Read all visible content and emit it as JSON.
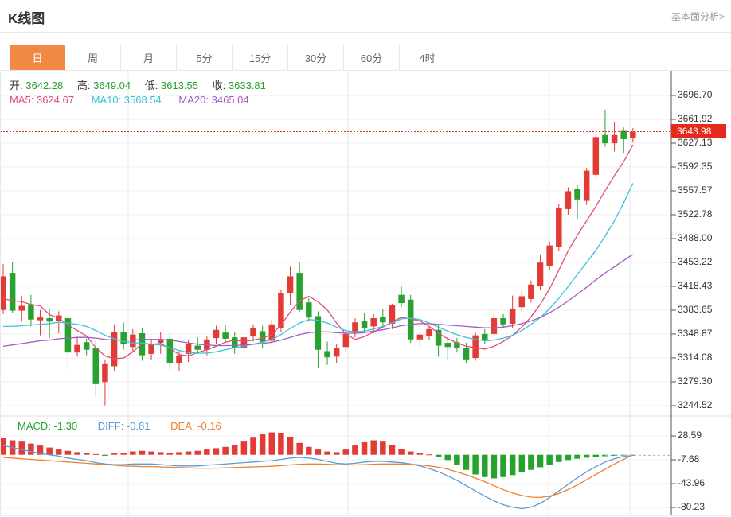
{
  "header": {
    "title": "K线图",
    "link": "基本面分析>"
  },
  "tabs": {
    "active_index": 0,
    "items": [
      {
        "key": "tab-day",
        "label": "日"
      },
      {
        "key": "tab-week",
        "label": "周"
      },
      {
        "key": "tab-month",
        "label": "月"
      },
      {
        "key": "tab-5min",
        "label": "5分"
      },
      {
        "key": "tab-15min",
        "label": "15分"
      },
      {
        "key": "tab-30min",
        "label": "30分"
      },
      {
        "key": "tab-60min",
        "label": "60分"
      },
      {
        "key": "tab-4hour",
        "label": "4时"
      }
    ]
  },
  "quote": {
    "open_label": "开:",
    "open": "3642.28",
    "high_label": "高:",
    "high": "3649.04",
    "low_label": "低:",
    "low": "3613.55",
    "close_label": "收:",
    "close": "3633.81"
  },
  "ma_info": {
    "ma5_label": "MA5:",
    "ma5": "3624.67",
    "ma10_label": "MA10:",
    "ma10": "3568.54",
    "ma20_label": "MA20:",
    "ma20": "3465.04"
  },
  "macd_info": {
    "macd_label": "MACD:",
    "macd": "-1.30",
    "diff_label": "DIFF:",
    "diff": "-0.81",
    "dea_label": "DEA:",
    "dea": "-0.16"
  },
  "price_marker": "3643.98",
  "colors": {
    "up": "#e23a34",
    "down": "#27a22e",
    "ma5": "#e14d78",
    "ma10": "#3bc2da",
    "ma20": "#a55bc1",
    "diff": "#5b9bd5",
    "dea": "#ed8132",
    "macd_green": "#27a22e",
    "accent_tab": "#f08a42",
    "marker": "#e5291d",
    "grid": "#efefef",
    "vgrid": "#e7e7e7",
    "axis": "#555555",
    "text": "#333333"
  },
  "chart_data": {
    "type": "candlestick+macd",
    "title": "K线图 日K",
    "legend": [
      "MA5",
      "MA10",
      "MA20",
      "MACD",
      "DIFF",
      "DEA"
    ],
    "main_axis_ticks": [
      3696.7,
      3661.92,
      3627.13,
      3592.35,
      3557.57,
      3522.78,
      3488.0,
      3453.22,
      3418.43,
      3383.65,
      3348.87,
      3314.08,
      3279.3,
      3244.52
    ],
    "current_price": 3643.98,
    "candles_ohlc": [
      [
        3384,
        3451,
        3378,
        3433
      ],
      [
        3438,
        3453,
        3380,
        3383
      ],
      [
        3383,
        3405,
        3367,
        3390
      ],
      [
        3392,
        3406,
        3360,
        3370
      ],
      [
        3369,
        3384,
        3347,
        3373
      ],
      [
        3372,
        3386,
        3343,
        3367
      ],
      [
        3368,
        3382,
        3350,
        3376
      ],
      [
        3372,
        3376,
        3297,
        3322
      ],
      [
        3322,
        3345,
        3316,
        3333
      ],
      [
        3337,
        3342,
        3318,
        3326
      ],
      [
        3329,
        3340,
        3258,
        3276
      ],
      [
        3279,
        3312,
        3245,
        3305
      ],
      [
        3302,
        3363,
        3295,
        3352
      ],
      [
        3352,
        3366,
        3326,
        3334
      ],
      [
        3330,
        3356,
        3322,
        3348
      ],
      [
        3350,
        3358,
        3310,
        3318
      ],
      [
        3320,
        3340,
        3312,
        3334
      ],
      [
        3336,
        3352,
        3320,
        3340
      ],
      [
        3342,
        3350,
        3297,
        3306
      ],
      [
        3306,
        3324,
        3295,
        3318
      ],
      [
        3320,
        3340,
        3308,
        3334
      ],
      [
        3332,
        3344,
        3320,
        3326
      ],
      [
        3326,
        3346,
        3318,
        3341
      ],
      [
        3343,
        3361,
        3335,
        3355
      ],
      [
        3351,
        3362,
        3336,
        3342
      ],
      [
        3344,
        3352,
        3320,
        3328
      ],
      [
        3328,
        3348,
        3322,
        3344
      ],
      [
        3346,
        3363,
        3338,
        3357
      ],
      [
        3353,
        3361,
        3329,
        3337
      ],
      [
        3339,
        3370,
        3333,
        3363
      ],
      [
        3357,
        3414,
        3351,
        3409
      ],
      [
        3409,
        3447,
        3391,
        3433
      ],
      [
        3438,
        3453,
        3381,
        3384
      ],
      [
        3395,
        3401,
        3367,
        3373
      ],
      [
        3375,
        3382,
        3299,
        3326
      ],
      [
        3324,
        3338,
        3304,
        3315
      ],
      [
        3316,
        3334,
        3306,
        3328
      ],
      [
        3330,
        3355,
        3324,
        3349
      ],
      [
        3351,
        3372,
        3344,
        3366
      ],
      [
        3368,
        3380,
        3352,
        3358
      ],
      [
        3360,
        3378,
        3350,
        3372
      ],
      [
        3374,
        3386,
        3360,
        3366
      ],
      [
        3364,
        3393,
        3356,
        3391
      ],
      [
        3406,
        3418,
        3388,
        3394
      ],
      [
        3399,
        3406,
        3336,
        3341
      ],
      [
        3341,
        3352,
        3328,
        3348
      ],
      [
        3346,
        3360,
        3340,
        3356
      ],
      [
        3355,
        3362,
        3316,
        3332
      ],
      [
        3336,
        3344,
        3312,
        3330
      ],
      [
        3337,
        3343,
        3322,
        3328
      ],
      [
        3329,
        3336,
        3306,
        3312
      ],
      [
        3314,
        3352,
        3310,
        3347
      ],
      [
        3349,
        3356,
        3334,
        3339
      ],
      [
        3349,
        3384,
        3343,
        3372
      ],
      [
        3372,
        3378,
        3358,
        3363
      ],
      [
        3364,
        3405,
        3357,
        3386
      ],
      [
        3388,
        3412,
        3382,
        3404
      ],
      [
        3400,
        3427,
        3395,
        3421
      ],
      [
        3419,
        3465,
        3413,
        3453
      ],
      [
        3448,
        3484,
        3442,
        3478
      ],
      [
        3476,
        3539,
        3470,
        3533
      ],
      [
        3531,
        3563,
        3523,
        3557
      ],
      [
        3560,
        3566,
        3517,
        3545
      ],
      [
        3543,
        3591,
        3537,
        3587
      ],
      [
        3581,
        3641,
        3575,
        3636
      ],
      [
        3639,
        3676,
        3622,
        3627
      ],
      [
        3627,
        3658,
        3615,
        3639
      ],
      [
        3645,
        3650,
        3613,
        3633
      ],
      [
        3634,
        3649,
        3628,
        3644
      ]
    ],
    "ma5": [
      3400,
      3398,
      3396,
      3392,
      3390,
      3377,
      3372,
      3362,
      3354,
      3346,
      3329,
      3317,
      3313,
      3314,
      3323,
      3335,
      3334,
      3335,
      3328,
      3319,
      3317,
      3322,
      3326,
      3331,
      3337,
      3340,
      3338,
      3340,
      3343,
      3348,
      3362,
      3381,
      3397,
      3404,
      3396,
      3384,
      3365,
      3349,
      3341,
      3345,
      3352,
      3359,
      3367,
      3373,
      3371,
      3368,
      3360,
      3350,
      3342,
      3336,
      3331,
      3329,
      3327,
      3331,
      3338,
      3347,
      3359,
      3374,
      3392,
      3415,
      3442,
      3470,
      3493,
      3514,
      3535,
      3558,
      3580,
      3600,
      3624.67
    ],
    "ma10": [
      3360,
      3360,
      3361,
      3362,
      3363,
      3364,
      3366,
      3365,
      3363,
      3360,
      3354,
      3347,
      3342,
      3338,
      3336,
      3336,
      3334,
      3333,
      3329,
      3325,
      3322,
      3321,
      3321,
      3323,
      3326,
      3329,
      3331,
      3334,
      3337,
      3341,
      3348,
      3357,
      3365,
      3370,
      3369,
      3365,
      3359,
      3354,
      3352,
      3353,
      3356,
      3360,
      3365,
      3371,
      3372,
      3370,
      3365,
      3359,
      3353,
      3348,
      3344,
      3341,
      3339,
      3340,
      3343,
      3347,
      3354,
      3363,
      3373,
      3386,
      3401,
      3418,
      3436,
      3453,
      3471,
      3492,
      3514,
      3540,
      3568.54
    ],
    "ma20": [
      3331,
      3333,
      3335,
      3337,
      3339,
      3340,
      3342,
      3343,
      3344,
      3344,
      3343,
      3341,
      3340,
      3340,
      3340,
      3341,
      3341,
      3341,
      3340,
      3338,
      3336,
      3334,
      3333,
      3332,
      3332,
      3332,
      3333,
      3334,
      3335,
      3337,
      3340,
      3344,
      3348,
      3351,
      3352,
      3352,
      3351,
      3350,
      3350,
      3351,
      3353,
      3355,
      3358,
      3361,
      3363,
      3364,
      3364,
      3363,
      3362,
      3361,
      3360,
      3359,
      3358,
      3358,
      3359,
      3361,
      3364,
      3368,
      3373,
      3380,
      3388,
      3397,
      3407,
      3417,
      3428,
      3438,
      3447,
      3456,
      3465.04
    ],
    "macd": {
      "axis_ticks": [
        28.59,
        -7.68,
        -43.96,
        -80.23
      ],
      "hist": [
        25,
        22,
        20,
        17,
        14,
        11,
        8,
        6,
        4,
        3,
        1,
        -1.5,
        2,
        3,
        5,
        6,
        5,
        4,
        3,
        4,
        5,
        6,
        8,
        10,
        12,
        15,
        20,
        26,
        31,
        34,
        33,
        27,
        18,
        12,
        8,
        5,
        4,
        8,
        14,
        19,
        22,
        20,
        15,
        9,
        5,
        2,
        0.5,
        -3,
        -8,
        -15,
        -23,
        -30,
        -34,
        -36,
        -34,
        -31,
        -27,
        -23,
        -19,
        -15,
        -11,
        -8,
        -6,
        -4.5,
        -3.2,
        -2.2,
        -1.6,
        -1.0,
        -1.3
      ],
      "diff": [
        14,
        11,
        8,
        5,
        2,
        0,
        -2,
        -5,
        -7,
        -9,
        -12,
        -14,
        -15,
        -15,
        -14,
        -14,
        -14,
        -15,
        -16,
        -17,
        -17,
        -17,
        -16,
        -15,
        -14,
        -13,
        -12,
        -11,
        -10,
        -9,
        -7,
        -5,
        -4,
        -5,
        -7,
        -10,
        -13,
        -14,
        -13,
        -11,
        -10,
        -10,
        -11,
        -12,
        -14,
        -17,
        -21,
        -26,
        -32,
        -39,
        -47,
        -55,
        -63,
        -70,
        -76,
        -80,
        -82,
        -80,
        -74,
        -65,
        -55,
        -45,
        -35,
        -26,
        -18,
        -11,
        -6,
        -2.5,
        -0.81
      ],
      "dea": [
        -4,
        -5,
        -6,
        -7,
        -8,
        -9,
        -10,
        -11,
        -12,
        -13,
        -14,
        -15,
        -16,
        -17,
        -17.5,
        -18,
        -18,
        -18.5,
        -19,
        -19.5,
        -20,
        -20.5,
        -20.5,
        -20.5,
        -20,
        -19.5,
        -19,
        -18.5,
        -18,
        -17.5,
        -16.5,
        -15.5,
        -14.5,
        -14,
        -14,
        -14.5,
        -15,
        -15.5,
        -15.5,
        -15,
        -14.5,
        -14,
        -14,
        -14,
        -14.5,
        -15.5,
        -17,
        -19,
        -22,
        -26,
        -30.5,
        -35.5,
        -41,
        -47,
        -53,
        -58,
        -62,
        -64.5,
        -65,
        -63,
        -59,
        -53,
        -46,
        -38,
        -30,
        -22,
        -14,
        -7,
        -0.16
      ]
    }
  }
}
